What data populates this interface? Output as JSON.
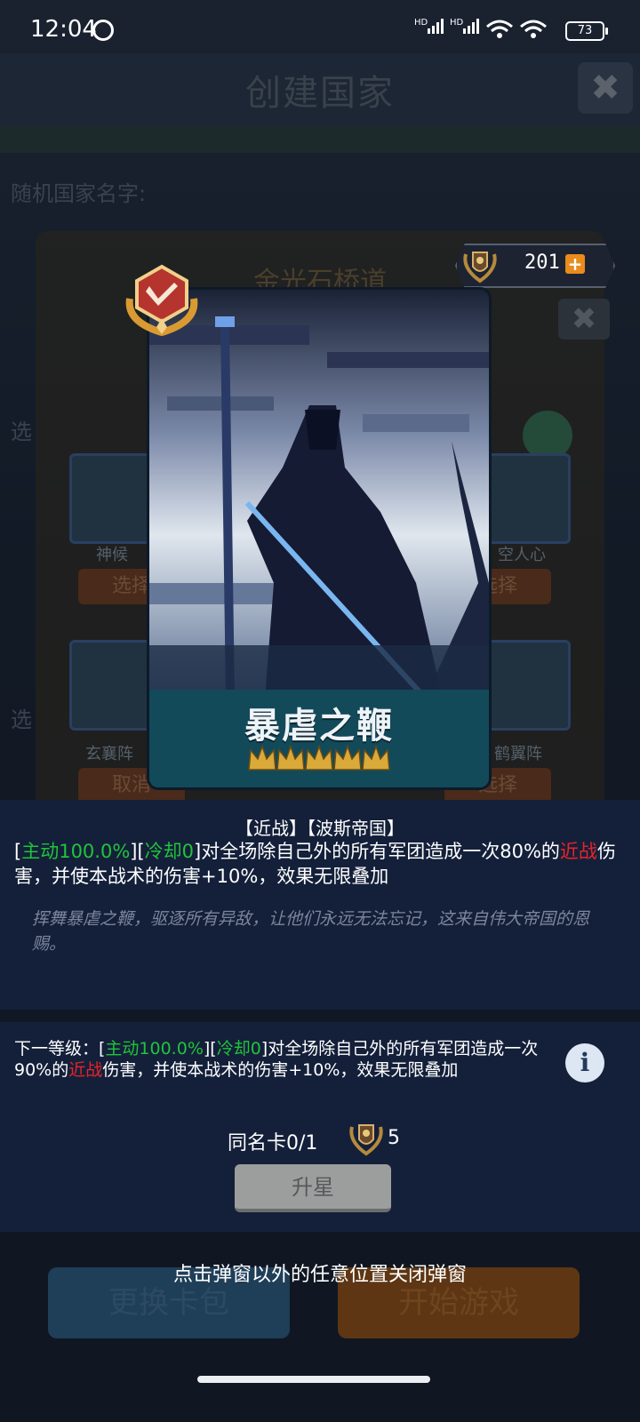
{
  "status_bar": {
    "time": "12:04",
    "signal1": "HD",
    "signal2": "HD",
    "battery": "73"
  },
  "background": {
    "title": "创建国家",
    "random_name_label": "随机国家名字:",
    "country_name": "金光石桥道",
    "side_label_1": "选",
    "side_label_2": "选",
    "cards": [
      {
        "name": "神候",
        "button": "选择"
      },
      {
        "name": "空人心",
        "button": "选择"
      },
      {
        "name": "玄襄阵",
        "button": "取消"
      },
      {
        "name": "鹤翼阵",
        "button": "选择"
      }
    ],
    "buttons": {
      "change_pack": "更换卡包",
      "start_game": "开始游戏"
    }
  },
  "currency": {
    "value": "201",
    "plus": "+",
    "icon": "laurel-shield-icon"
  },
  "card": {
    "name": "暴虐之鞭",
    "stars": 5,
    "badge_icon": "sword-rank-badge-icon"
  },
  "description": {
    "tags": "【近战】【波斯帝国】",
    "effect": {
      "b1": "[",
      "active": "主动100.0%",
      "b2": "][",
      "cooldown": "冷却0",
      "t1": "]对全场除自己外的所有军团造成一次80%的",
      "melee": "近战",
      "t2": "伤害，并使本战术的伤害+10%，效果无限叠加"
    },
    "flavor": "挥舞暴虐之鞭，驱逐所有异敌，让他们永远无法忘记，这来自伟大帝国的恩赐。"
  },
  "next_level": {
    "prefix": "下一等级：[",
    "active": "主动100.0%",
    "b2": "][",
    "cooldown": "冷却0",
    "t1": "]对全场除自己外的所有军团造成一次90%的",
    "melee": "近战",
    "t2": "伤害，并使本战术的伤害+10%，效果无限叠加"
  },
  "info_icon": "i",
  "copies": {
    "label": "同名卡0/1",
    "cost": "5"
  },
  "upgrade_button": "升星",
  "close_hint": "点击弹窗以外的任意位置关闭弹窗"
}
